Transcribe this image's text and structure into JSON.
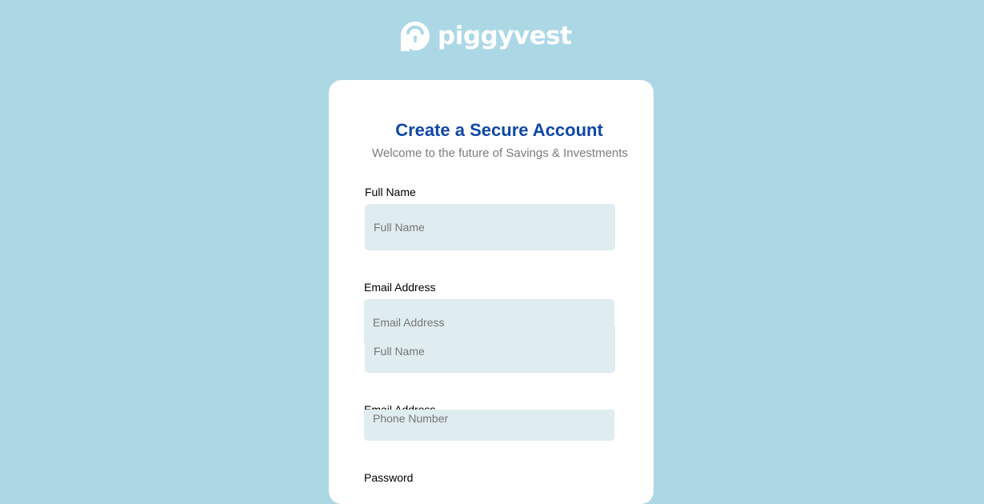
{
  "brand": {
    "name": "piggyvest",
    "logo_icon": "padlock-logo-icon",
    "color": "#ffffff"
  },
  "colors": {
    "background": "#acd8e6",
    "card": "#ffffff",
    "title": "#0f47a8",
    "input_fill": "#dfecf0"
  },
  "form": {
    "title": "Create a Secure Account",
    "subtitle": "Welcome to the future of Savings & Investments",
    "full_name": {
      "label": "Full Name",
      "placeholder": "Full Name"
    },
    "email": {
      "label": "Email Address",
      "placeholder": "Email Address"
    },
    "full_name_dup": {
      "placeholder": "Full Name"
    },
    "email_dup": {
      "label": "Email Address"
    },
    "phone": {
      "placeholder": "Phone Number"
    },
    "password": {
      "label": "Password"
    }
  }
}
